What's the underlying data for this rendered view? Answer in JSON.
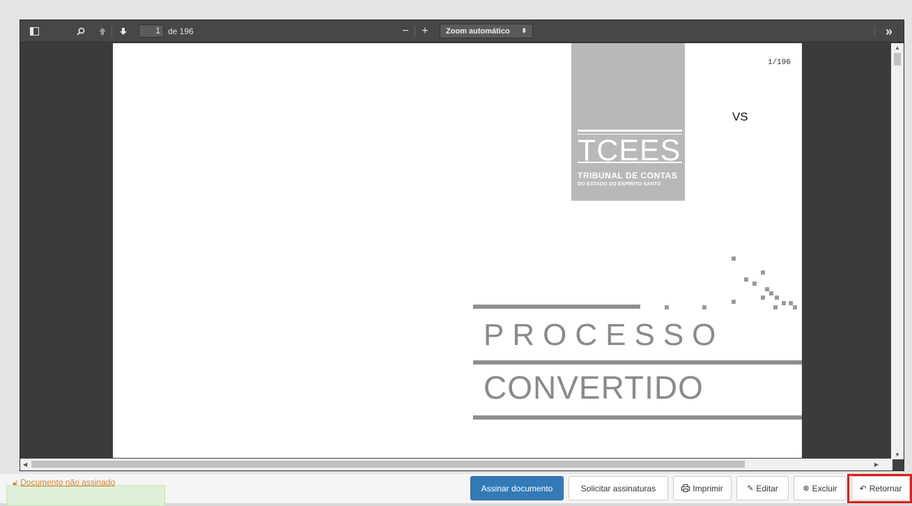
{
  "toolbar": {
    "page_current": "1",
    "page_of": "de 196",
    "zoom_minus": "−",
    "zoom_plus": "+",
    "zoom_label": "Zoom automático",
    "zoom_caret": "⬍",
    "more_tools": "»"
  },
  "document": {
    "page_counter": "1/196",
    "vs_text": "VS",
    "logo_letters": "TCEES",
    "logo_line1": "TRIBUNAL DE CONTAS",
    "logo_line2": "DO ESTADO DO ESPÍRITO SANTO",
    "title_line1": "PROCESSO",
    "title_line2": "CONVERTIDO"
  },
  "footer": {
    "status_text": "Documento não assinado",
    "buttons": {
      "sign": "Assinar documento",
      "request": "Solicitar assinaturas",
      "print": "Imprimir",
      "edit": "Editar",
      "delete": "Excluir",
      "back": "Retornar"
    }
  },
  "colors": {
    "primary_button": "#337ab7",
    "status_warning": "#d9822b",
    "highlight": "#e01b1b"
  }
}
